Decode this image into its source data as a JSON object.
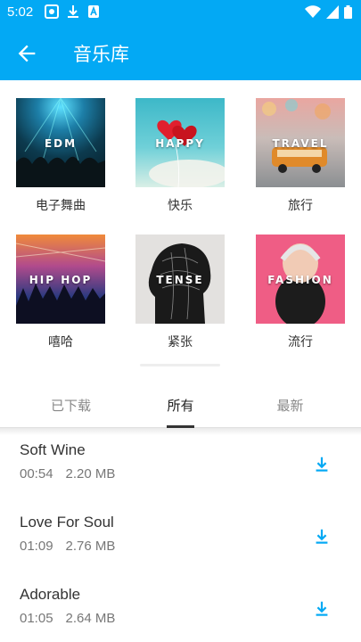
{
  "status_bar": {
    "time": "5:02",
    "left_icons": [
      "screenshot-icon",
      "download-icon",
      "a-icon"
    ],
    "right_icons": [
      "wifi-icon",
      "signal-icon",
      "battery-icon"
    ]
  },
  "app_bar": {
    "title": "音乐库",
    "back_icon": "arrow-left-icon",
    "color": "#03A9F4"
  },
  "categories": [
    {
      "label": "EDM",
      "name": "电子舞曲"
    },
    {
      "label": "HAPPY",
      "name": "快乐"
    },
    {
      "label": "TRAVEL",
      "name": "旅行"
    },
    {
      "label": "HIP HOP",
      "name": "嘻哈"
    },
    {
      "label": "TENSE",
      "name": "紧张"
    },
    {
      "label": "FASHION",
      "name": "流行"
    }
  ],
  "tabs": [
    {
      "label": "已下载",
      "active": false
    },
    {
      "label": "所有",
      "active": true
    },
    {
      "label": "最新",
      "active": false
    }
  ],
  "songs": [
    {
      "title": "Soft Wine",
      "duration": "00:54",
      "size": "2.20 MB"
    },
    {
      "title": "Love For Soul",
      "duration": "01:09",
      "size": "2.76 MB"
    },
    {
      "title": "Adorable",
      "duration": "01:05",
      "size": "2.64 MB"
    }
  ],
  "accent_color": "#03A9F4"
}
